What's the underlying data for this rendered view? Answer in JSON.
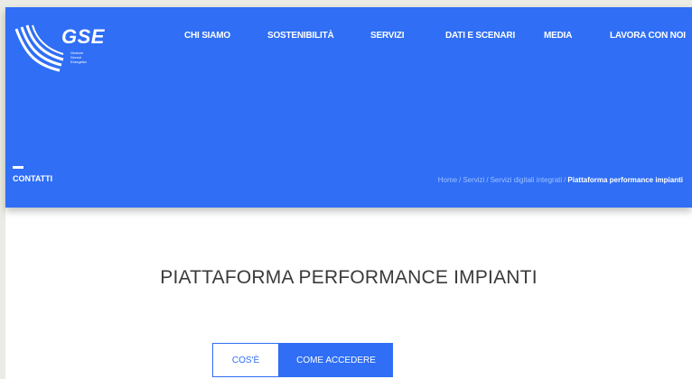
{
  "header": {
    "logo_text": "GSE",
    "logo_sub": [
      "Gestore",
      "Servizi",
      "Energetici"
    ],
    "nav": [
      {
        "label": "CHI SIAMO"
      },
      {
        "label": "SOSTENIBILITÀ"
      },
      {
        "label": "SERVIZI"
      },
      {
        "label": "DATI E SCENARI"
      },
      {
        "label": "MEDIA"
      },
      {
        "label": "LAVORA CON NOI"
      }
    ],
    "contacts_label": "CONTATTI",
    "colors": {
      "brand": "#2f6ef5",
      "text_on_brand": "#ffffff"
    }
  },
  "breadcrumb": {
    "items": [
      "Home",
      "Servizi",
      "Servizi digitali integrati"
    ],
    "separator": "/",
    "current": "Piattaforma performance impianti"
  },
  "main": {
    "title": "PIATTAFORMA PERFORMANCE IMPIANTI",
    "tabs": [
      {
        "label": "COS'È",
        "active": false
      },
      {
        "label": "COME ACCEDERE",
        "active": true
      }
    ]
  }
}
